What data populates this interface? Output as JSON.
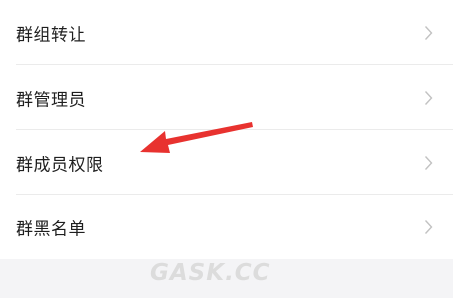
{
  "menu": {
    "items": [
      {
        "label": "群组转让"
      },
      {
        "label": "群管理员"
      },
      {
        "label": "群成员权限"
      },
      {
        "label": "群黑名单"
      }
    ]
  },
  "annotation": {
    "arrow_color": "#e8322f"
  },
  "watermark": {
    "text": "GASK.CC"
  },
  "icons": {
    "chevron": "chevron-right-icon",
    "arrow": "arrow-icon"
  }
}
